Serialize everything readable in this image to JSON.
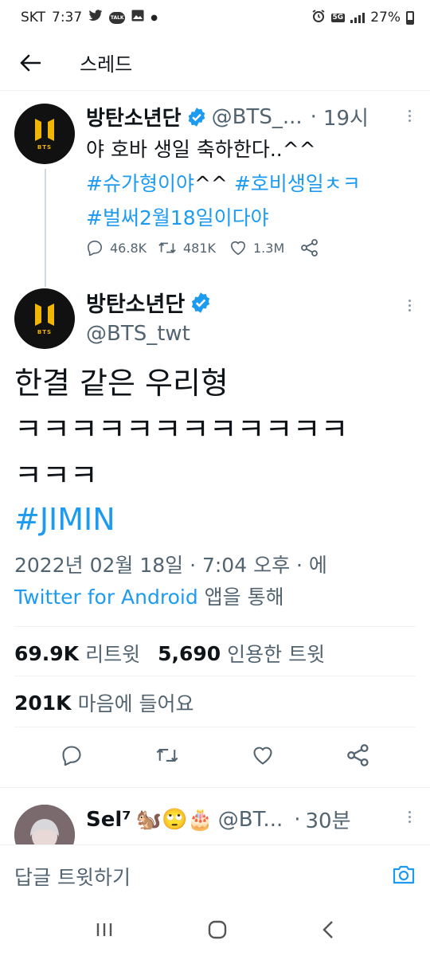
{
  "status_bar": {
    "carrier": "SKT",
    "time": "7:37",
    "talk_badge": "TALK",
    "network": "5G",
    "battery": "27%"
  },
  "header": {
    "title": "스레드"
  },
  "tweet_parent": {
    "name": "방탄소년단",
    "handle": "@BTS_...",
    "time_sep": "·",
    "time": "19시",
    "text": "야 호바 생일 축하한다..^^",
    "hashtags_line1_a": "#슈가형이야",
    "hashtags_line1_mid": "^^",
    "hashtags_line1_b": "#호비생일ㅊㅋ",
    "hashtags_line2": "#벌써2월18일이다야",
    "replies": "46.8K",
    "retweets": "481K",
    "likes": "1.3M"
  },
  "tweet_main": {
    "name": "방탄소년단",
    "handle": "@BTS_twt",
    "text_line1": "한결 같은 우리형",
    "text_line2": "ㅋㅋㅋㅋㅋㅋㅋㅋㅋㅋㅋㅋ",
    "text_line3": "ㅋㅋㅋ",
    "hashtag": "#JIMIN",
    "date": "2022년 02월 18일 · 7:04 오후 · 에",
    "via": "Twitter for Android",
    "via_suffix": "앱을 통해",
    "retweet_count": "69.9K",
    "retweet_label": "리트윗",
    "quote_count": "5,690",
    "quote_label": "인용한 트윗",
    "like_count": "201K",
    "like_label": "마음에 들어요"
  },
  "reply_preview": {
    "name": "Sel⁷",
    "emojis": "🐿️🙄🎂",
    "handle": "@BT...",
    "time_sep": "·",
    "time": "30분"
  },
  "reply_bar": {
    "placeholder": "답글 트윗하기"
  },
  "colors": {
    "accent": "#1d9bf0",
    "text": "#0f1419",
    "muted": "#536471"
  }
}
